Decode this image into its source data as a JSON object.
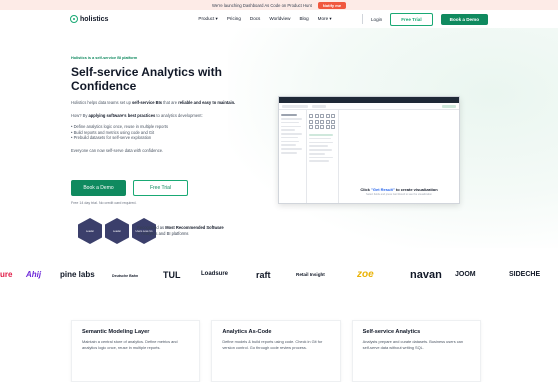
{
  "announcement": {
    "text": "We're launching Dashboard As Code on Product Hunt",
    "button": "Notify me"
  },
  "nav": {
    "brand": "holistics",
    "items": [
      "Product ▾",
      "Pricing",
      "Docs",
      "Worldview",
      "Blog",
      "More ▾"
    ],
    "login": "Login",
    "free_trial": "Free Trial",
    "book_demo": "Book a Demo"
  },
  "hero": {
    "eyebrow": "Holistics is a self-service BI platform",
    "title_line1": "Self-service Analytics with",
    "title_line2": "Confidence",
    "desc_prefix": "Holistics helps data teams set up ",
    "desc_bold1": "self-service BIs",
    "desc_mid": " that are ",
    "desc_bold2": "reliable and easy to maintain.",
    "how_prefix": "How? By ",
    "how_bold": "applying software's best practices",
    "how_suffix": " to analytics development:",
    "bullets": [
      "• Define analytics logic once, reuse in multiple reports",
      "• Build reports and metrics using code and Git",
      "• Prebuild datasets for self-serve exploration"
    ],
    "closing": "Everyone can now self-serve data with confidence.",
    "cta_demo": "Book a Demo",
    "cta_trial": "Free Trial",
    "trial_note": "Free 14 day trial. No credit card required."
  },
  "badges": [
    "Leader",
    "Leader",
    "Users Love Us"
  ],
  "recognition": {
    "prefix": "Recognized as ",
    "bold": "Most Recommended Software",
    "suffix": " in Analytics and BI platforms"
  },
  "app_preview": {
    "run_prefix": "Click ",
    "run_link": "\"Get Result\"",
    "run_suffix": " to create visualization",
    "run_sub": "Select fields and press Get Result to see the visualization"
  },
  "customer_logos": [
    "ure",
    "Ahij",
    "pine labs",
    "Deutsche Bahn",
    "TUL",
    "Loadsure",
    "raft",
    "Retail Insight",
    "zoe",
    "navan",
    "JOOM",
    "SIDECHE"
  ],
  "features": [
    {
      "title": "Semantic Modeling Layer",
      "desc": "Maintain a central store of analytics. Define metrics and analytics logic once, reuse in multiple reports."
    },
    {
      "title": "Analytics As-Code",
      "desc": "Define models & build reports using code. Check in Git for version control. Go through code review process."
    },
    {
      "title": "Self-service Analytics",
      "desc": "Analysts prepare and curate datasets. Business users can self-serve data without writing SQL."
    }
  ],
  "colors": {
    "brand_green": "#0f8a5f",
    "announce_bg": "#fdebe7",
    "notify": "#f0583f"
  }
}
